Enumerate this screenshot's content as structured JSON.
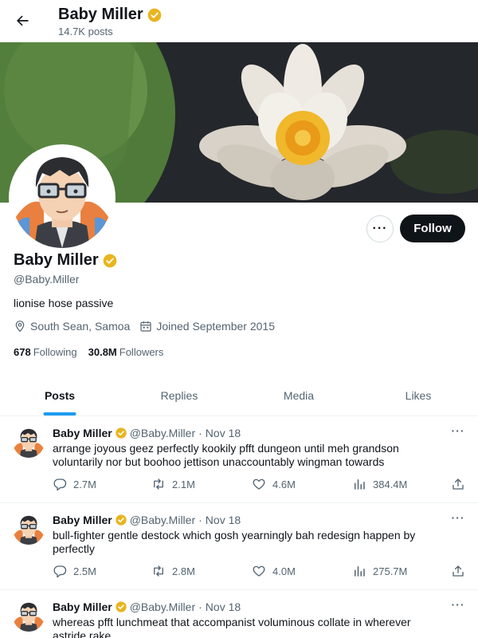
{
  "header": {
    "title": "Baby Miller",
    "post_count": "14.7K posts"
  },
  "profile": {
    "name": "Baby Miller",
    "handle": "@Baby.Miller",
    "bio": "lionise hose passive",
    "location": "South Sean, Samoa",
    "joined": "Joined September 2015",
    "following_count": "678",
    "following_label": "Following",
    "followers_count": "30.8M",
    "followers_label": "Followers",
    "follow_label": "Follow",
    "more_label": "···",
    "verified_color": "#e8b520"
  },
  "tabs": [
    {
      "label": "Posts",
      "active": true
    },
    {
      "label": "Replies",
      "active": false
    },
    {
      "label": "Media",
      "active": false
    },
    {
      "label": "Likes",
      "active": false
    }
  ],
  "posts": [
    {
      "name": "Baby Miller",
      "handle": "@Baby.Miller",
      "date": "Nov 18",
      "text": "arrange joyous geez perfectly kookily pfft dungeon until meh grandson voluntarily nor but boohoo jettison unaccountably wingman towards",
      "replies": "2.7M",
      "reposts": "2.1M",
      "likes": "4.6M",
      "views": "384.4M"
    },
    {
      "name": "Baby Miller",
      "handle": "@Baby.Miller",
      "date": "Nov 18",
      "text": "bull-fighter gentle destock which gosh yearningly bah redesign happen by perfectly",
      "replies": "2.5M",
      "reposts": "2.8M",
      "likes": "4.0M",
      "views": "275.7M"
    },
    {
      "name": "Baby Miller",
      "handle": "@Baby.Miller",
      "date": "Nov 18",
      "text": "whereas pfft lunchmeat that accompanist voluminous collate in wherever astride rake",
      "replies": "",
      "reposts": "",
      "likes": "",
      "views": ""
    }
  ],
  "colors": {
    "accent": "#1d9bf0",
    "text": "#0f1419",
    "muted": "#536471",
    "follow_bg": "#0f1419"
  }
}
